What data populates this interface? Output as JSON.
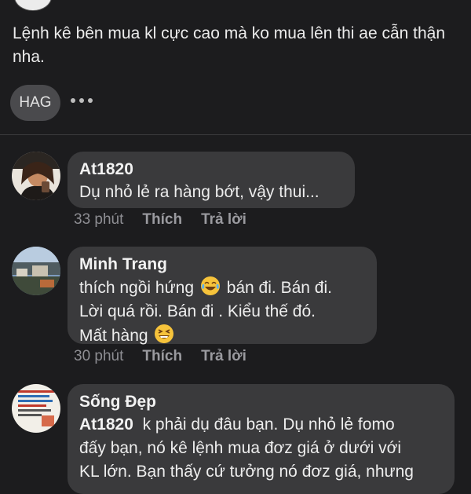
{
  "post": {
    "text": "Lệnh kê bên mua kl cực cao mà ko mua lên thi ae cẫn thận nha.",
    "hashtag": "HAG"
  },
  "comments": [
    {
      "author": "At1820",
      "text": "Dụ nhỏ lẻ ra hàng bớt, vậy thui...",
      "time": "33 phút",
      "like": "Thích",
      "reply": "Trả lời"
    },
    {
      "author": "Minh Trang",
      "line1_a": "thích ngồi hứng",
      "line1_b": "bán đi. Bán đi.",
      "line2": "Lời quá rồi. Bán đi . Kiểu thế đó.",
      "line3": "Mất hàng",
      "time": "30 phút",
      "like": "Thích",
      "reply": "Trả lời"
    },
    {
      "author": "Sống Đẹp",
      "mention": "At1820",
      "line1": "k phải dụ đâu bạn. Dụ nhỏ lẻ fomo",
      "line2": "đấy bạn, nó kê lệnh mua đơz giá ở dưới với",
      "line3": "KL lớn. Bạn thấy cứ tưởng nó đơz giá, nhưng"
    }
  ],
  "icons": {
    "more": "more-horizontal-icon",
    "laugh_emoji": "tears-of-joy-emoji",
    "grin_emoji": "squinting-grin-emoji"
  },
  "colors": {
    "background": "#1c1c1e",
    "bubble": "#3a3a3c",
    "chip": "#4a4a4d",
    "meta_text": "#8e8e93"
  }
}
